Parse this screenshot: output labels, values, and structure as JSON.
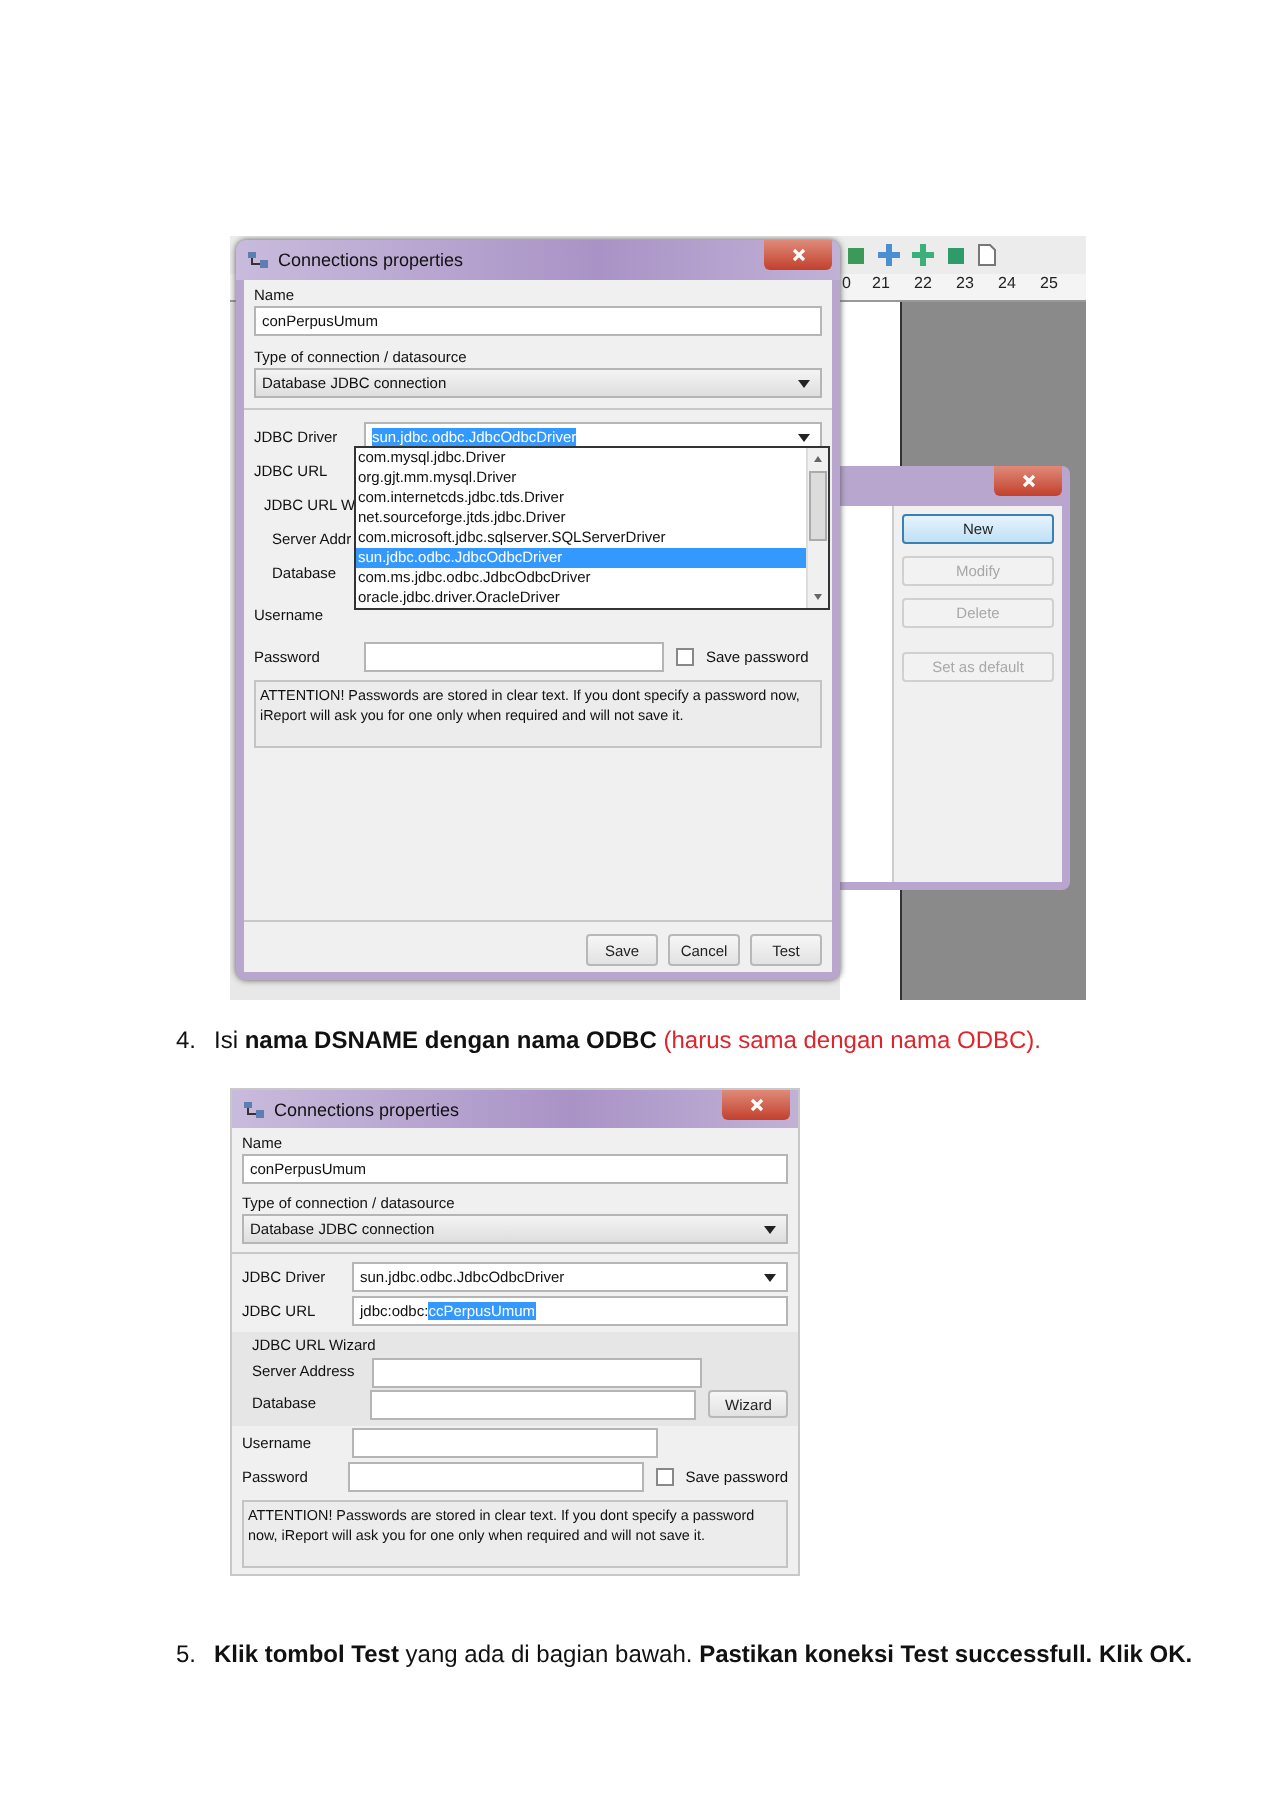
{
  "screenshot_1": {
    "ruler_numbers": [
      "0",
      "21",
      "22",
      "23",
      "24",
      "25"
    ],
    "connections_window": {
      "buttons": [
        {
          "label": "New",
          "disabled": false,
          "focused": true
        },
        {
          "label": "Modify",
          "disabled": true,
          "focused": false
        },
        {
          "label": "Delete",
          "disabled": true,
          "focused": false
        },
        {
          "label": "Set as default",
          "disabled": true,
          "focused": false
        }
      ]
    },
    "dialog": {
      "title": "Connections properties",
      "name_label": "Name",
      "name_value": "conPerpusUmum",
      "type_label": "Type of connection / datasource",
      "type_value": "Database JDBC connection",
      "driver_label": "JDBC Driver",
      "driver_value": "sun.jdbc.odbc.JdbcOdbcDriver",
      "driver_value_selected": true,
      "url_label": "JDBC URL",
      "wizard_label": "JDBC URL W",
      "server_label": "Server Addr",
      "database_label": "Database",
      "username_label": "Username",
      "password_label": "Password",
      "save_password_label": "Save password",
      "save_password_checked": false,
      "attention": "ATTENTION! Passwords are stored in clear text. If you dont specify a password now, iReport will ask you for one only when required and will not save it.",
      "buttons": [
        "Save",
        "Cancel",
        "Test"
      ],
      "driver_options": [
        {
          "label": "com.mysql.jdbc.Driver",
          "selected": false
        },
        {
          "label": "org.gjt.mm.mysql.Driver",
          "selected": false
        },
        {
          "label": "com.internetcds.jdbc.tds.Driver",
          "selected": false
        },
        {
          "label": "net.sourceforge.jtds.jdbc.Driver",
          "selected": false
        },
        {
          "label": "com.microsoft.jdbc.sqlserver.SQLServerDriver",
          "selected": false
        },
        {
          "label": "sun.jdbc.odbc.JdbcOdbcDriver",
          "selected": true
        },
        {
          "label": "com.ms.jdbc.odbc.JdbcOdbcDriver",
          "selected": false
        },
        {
          "label": "oracle.jdbc.driver.OracleDriver",
          "selected": false
        }
      ]
    }
  },
  "step_4": {
    "number": "4.",
    "text": "Isi **nama DSNAME dengan nama ODBC**",
    "warning": "(harus sama dengan nama ODBC)."
  },
  "screenshot_2": {
    "dialog": {
      "title": "Connections properties",
      "name_label": "Name",
      "name_value": "conPerpusUmum",
      "type_label": "Type of connection / datasource",
      "type_value": "Database JDBC connection",
      "driver_label": "JDBC Driver",
      "driver_value": "sun.jdbc.odbc.JdbcOdbcDriver",
      "driver_value_selected": false,
      "url_label": "JDBC URL",
      "url_value": [
        {
          "text": "jdbc:odbc:",
          "selected": false
        },
        {
          "text": "ccPerpusUmum",
          "selected": true
        }
      ],
      "wizard_label": "JDBC URL Wizard",
      "server_label": "Server Address",
      "database_label": "Database",
      "wizard_button": "Wizard",
      "username_label": "Username",
      "password_label": "Password",
      "save_password_label": "Save password",
      "save_password_checked": false,
      "attention": "ATTENTION! Passwords are stored in clear text. If you dont specify a password now, iReport will ask you for one only when required and will not save it."
    }
  },
  "step_5": {
    "number": "5.",
    "text": "**Klik tombol Test** yang ada di bagian bawah. **Pastikan koneksi Test successfull. Klik OK.**"
  }
}
